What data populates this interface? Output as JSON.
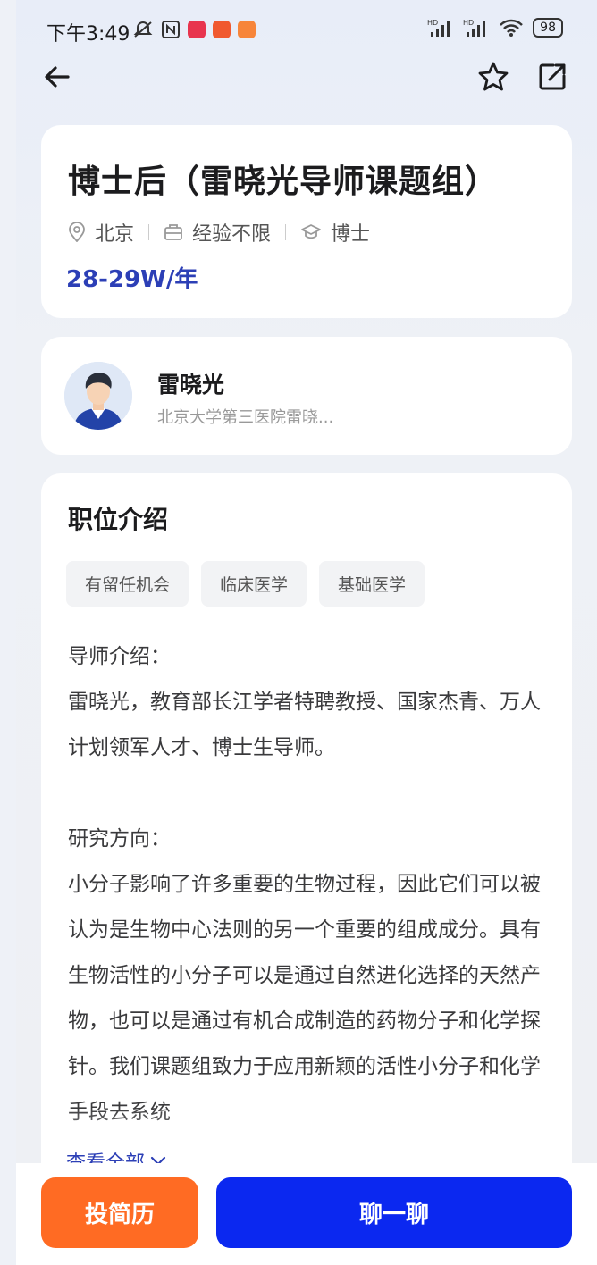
{
  "status_bar": {
    "time": "下午3:49",
    "battery": "98",
    "network_label": "HD"
  },
  "navbar": {
    "back_icon": "arrow-left-icon",
    "favorite_icon": "star-icon",
    "share_icon": "share-icon"
  },
  "job": {
    "title": "博士后（雷晓光导师课题组）",
    "location": "北京",
    "experience": "经验不限",
    "education": "博士",
    "salary": "28-29W/年"
  },
  "recruiter": {
    "name": "雷晓光",
    "org": "北京大学第三医院雷晓..."
  },
  "description": {
    "section_title": "职位介绍",
    "tags": [
      "有留任机会",
      "临床医学",
      "基础医学"
    ],
    "mentor_heading": "导师介绍：",
    "mentor_text": "雷晓光，教育部长江学者特聘教授、国家杰青、万人计划领军人才、博士生导师。",
    "research_heading": "研究方向：",
    "research_text": "小分子影响了许多重要的生物过程，因此它们可以被认为是生物中心法则的另一个重要的组成成分。具有生物活性的小分子可以是通过自然进化选择的天然产物，也可以是通过有机合成制造的药物分子和化学探针。我们课题组致力于应用新颖的活性小分子和化学手段去系统",
    "view_all": "查看全部"
  },
  "actions": {
    "resume_label": "投简历",
    "chat_label": "聊一聊"
  },
  "colors": {
    "accent_blue": "#2c3fb6",
    "chat_button": "#0b28f0",
    "resume_button": "#ff6b23"
  }
}
